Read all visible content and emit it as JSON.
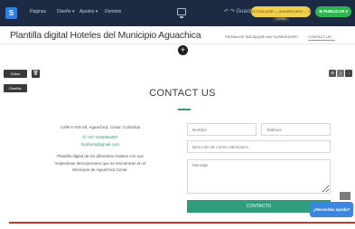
{
  "editor": {
    "logo": "S",
    "menu": [
      "Páginas",
      "Diseño ▾",
      "Ajustes ▾",
      "Dominio"
    ],
    "undo": "↶ ↷ Guardado",
    "update_label": "ACTUALIZAR — AHORRA 60% — 449",
    "update_sub": "TURBO",
    "publish_label": "⊕ PUBLICAR ▾"
  },
  "site": {
    "title": "Plantilla digital Hoteles del Municipio Aguachica",
    "nav": [
      "PÁGINA DE INICIO",
      "¿QUÉ HAY ALREDEDOR?",
      "CONTACT US"
    ]
  },
  "tools": {
    "edit_label": "Editar",
    "design_label": "Diseñar",
    "trash_icon": "🗑",
    "right_icons": [
      "⚙",
      "↑",
      "↓"
    ]
  },
  "contact": {
    "heading": "CONTACT US",
    "address": "Calle 5 #16-28, Aguachica, Cesar, Colombia",
    "phone": "✆ +57 3183484487",
    "email": "hsoforos@gmail.com",
    "description": "Plantilla digital de los diferentes hoteles con sus respectivas descripciones que se encuentran en el Municipio de Aguachica Cesar."
  },
  "form": {
    "name_placeholder": "Nombre",
    "phone_placeholder": "Teléfono",
    "email_placeholder": "Dirección de correo electrónico",
    "message_placeholder": "Mensaje",
    "submit_label": "CONTACTO"
  },
  "help": {
    "label": "¿Necesitás ayuda?"
  },
  "colors": {
    "accent": "#2f9c7e",
    "editor_bg": "#1c2a44",
    "publish": "#2fb551",
    "update": "#f2cf4b",
    "help": "#3b86e0"
  }
}
